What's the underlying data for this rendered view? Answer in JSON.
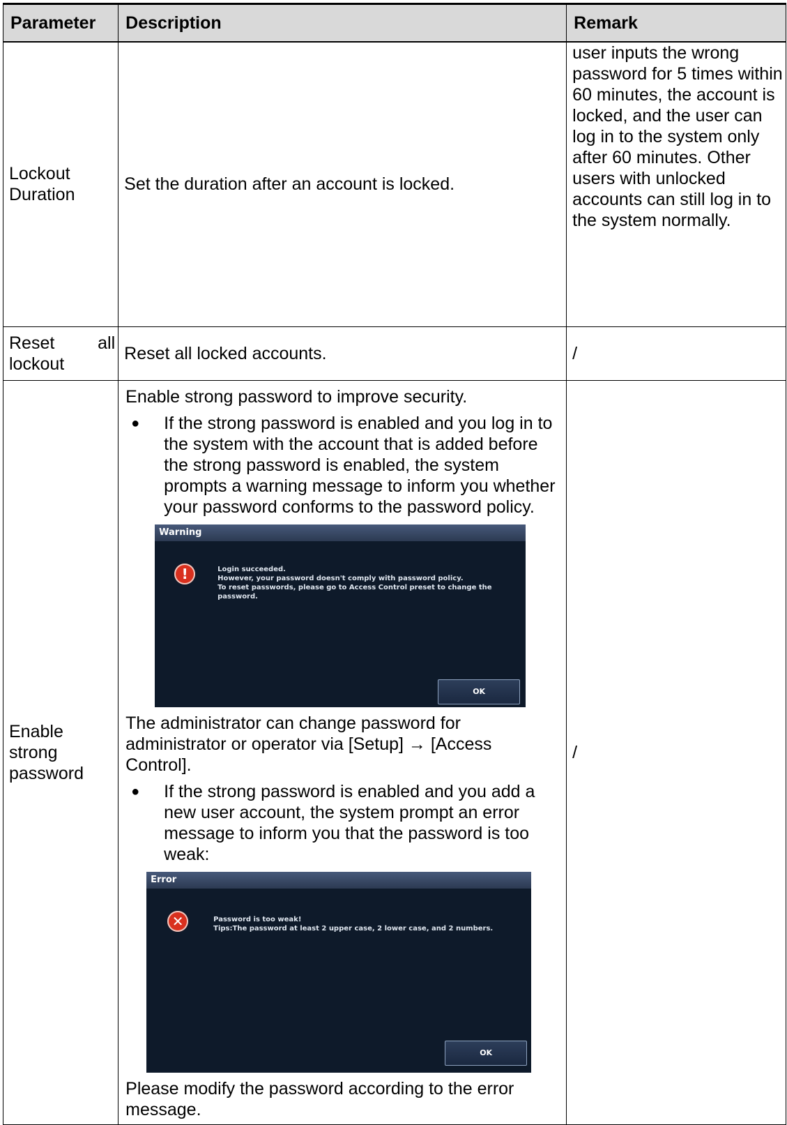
{
  "headers": {
    "parameter": "Parameter",
    "description": "Description",
    "remark": "Remark"
  },
  "rows": {
    "lockout_duration": {
      "parameter": "Lockout Duration",
      "description": "Set the duration after an account is locked.",
      "remark": "user inputs the wrong password for 5 times within 60 minutes, the account is locked, and the user can log in to the system only after 60 minutes. Other users with unlocked accounts can still log in to the system normally."
    },
    "reset_all_lockout": {
      "parameter_word1": "Reset",
      "parameter_word2": "all",
      "parameter_word3": "lockout",
      "description": "Reset all locked accounts.",
      "remark": "/"
    },
    "enable_strong_password": {
      "parameter": "Enable strong password",
      "intro": "Enable strong password to improve security.",
      "bullet1": "If the strong password is enabled and you log in to the system with the account that is added before the strong password is enabled, the system prompts a warning message to inform you whether your password conforms to the password policy.",
      "warning_dialog": {
        "title": "Warning",
        "line1": "Login succeeded.",
        "line2": "However, your password doesn't comply with password policy.",
        "line3": "To reset passwords, please go to Access Control preset to change the",
        "line4": "password.",
        "ok": "OK"
      },
      "admin_text": "The administrator can change password for administrator or operator via [Setup] → [Access Control].",
      "bullet2": "If the strong password is enabled and you add a new user account, the system prompt an error message to inform you that the password is too weak:",
      "error_dialog": {
        "title": "Error",
        "line1": "Password is too weak!",
        "line2": "Tips:The password at least 2 upper case, 2 lower case, and 2 numbers.",
        "ok": "OK"
      },
      "closing": "Please modify the password according to the error message.",
      "remark": "/"
    }
  },
  "bullet_symbol": "●",
  "colors": {
    "header_bg": "#d9d9d9",
    "dialog_bg": "#0e1a2a",
    "warning_icon": "#d9301e",
    "error_icon": "#d9301e"
  }
}
